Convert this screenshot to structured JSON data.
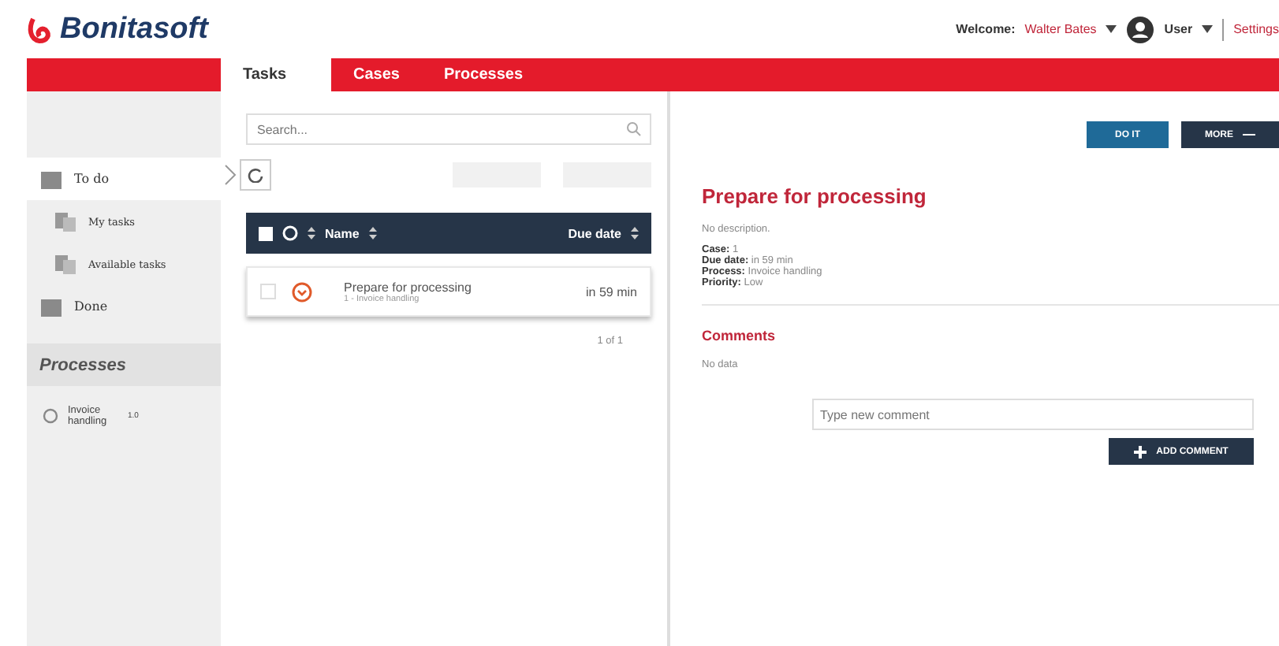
{
  "header": {
    "logo": "Bonitasoft",
    "welcome": "Welcome:",
    "user_name": "Walter Bates",
    "profile": "User",
    "settings": "Settings"
  },
  "tabs": [
    {
      "label": "Tasks",
      "selected": true
    },
    {
      "label": "Cases",
      "selected": false
    },
    {
      "label": "Processes",
      "selected": false
    }
  ],
  "sidebar": {
    "items": [
      {
        "label": "To do",
        "selected": true,
        "children": [
          {
            "label": "My tasks",
            "selected": false
          },
          {
            "label": "Available tasks",
            "selected": false
          }
        ]
      },
      {
        "label": "Done",
        "selected": false
      }
    ],
    "processes_title": "Processes",
    "processes": [
      {
        "name": "Invoice handling",
        "version": "1.0"
      }
    ]
  },
  "task_list": {
    "search": {
      "placeholder": "Search..."
    },
    "action_buttons": [
      {
        "disabled": true
      },
      {
        "disabled": true
      }
    ],
    "select_all": {
      "checked": false
    },
    "columns": [
      "Name",
      "Due date"
    ],
    "rows": [
      {
        "name": "Prepare for processing",
        "subtitle": "1 - Invoice handling",
        "due": "in 59 min",
        "selected": true,
        "checked": false
      }
    ],
    "pager": "1 of 1"
  },
  "details": {
    "buttons": [
      {
        "label": "DO IT",
        "kind": "primary"
      },
      {
        "label": "MORE",
        "kind": "dark"
      }
    ],
    "title": "Prepare for processing",
    "description": "No description.",
    "fields": [
      {
        "label": "Case:",
        "value": "1"
      },
      {
        "label": "Due date:",
        "value": "in 59 min"
      },
      {
        "label": "Process:",
        "value": "Invoice handling"
      },
      {
        "label": "Priority:",
        "value": "Low"
      }
    ],
    "comments_title": "Comments",
    "comments_empty": "No data",
    "comment_field": {
      "placeholder": "Type new comment"
    },
    "add_comment": "ADD COMMENT"
  }
}
